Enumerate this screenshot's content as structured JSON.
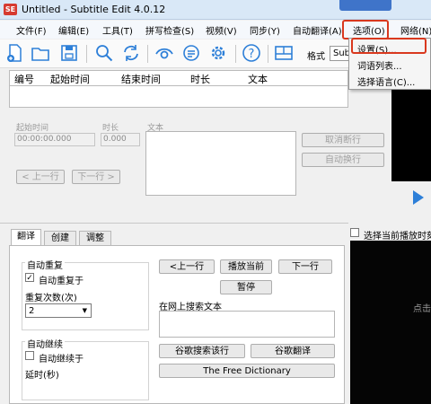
{
  "window": {
    "title": "Untitled - Subtitle Edit 4.0.12",
    "app_icon": "SE"
  },
  "menu": [
    "文件(F)",
    "编辑(E)",
    "工具(T)",
    "拼写检查(S)",
    "视频(V)",
    "同步(Y)",
    "自动翻译(A)",
    "选项(O)",
    "网络(N)"
  ],
  "options_menu": [
    "设置(S)...",
    "词语列表...",
    "选择语言(C)..."
  ],
  "toolbar": {
    "format_label": "格式",
    "format_value": "Sub"
  },
  "grid": {
    "columns": [
      "编号",
      "起始时间",
      "结束时间",
      "时长",
      "文本"
    ]
  },
  "editor": {
    "start_label": "起始时间",
    "start_value": "00:00:00.000",
    "duration_label": "时长",
    "duration_value": "0.000",
    "text_label": "文本",
    "prev_btn": "< 上一行",
    "next_btn": "下一行 >",
    "unbreak_btn": "取消断行",
    "autobreak_btn": "自动换行"
  },
  "tabs": [
    "翻译",
    "创建",
    "调整"
  ],
  "translate": {
    "auto_repeat_group": "自动重复",
    "auto_repeat_on": "自动重复于",
    "repeat_count_label": "重复次数(次)",
    "repeat_count_value": "2",
    "auto_continue_group": "自动继续",
    "auto_continue_on": "自动继续于",
    "delay_label": "延时(秒)",
    "prev_line_btn": "<上一行",
    "play_current_btn": "播放当前",
    "next_line_btn": "下一行",
    "pause_btn": "暂停",
    "search_label": "在网上搜索文本",
    "google_search_btn": "谷歌搜索该行",
    "google_translate_btn": "谷歌翻译",
    "free_dict_btn": "The Free Dictionary"
  },
  "video_panel": {
    "select_current_label": "选择当前播放时刻",
    "click_hint": "点击"
  },
  "colors": {
    "accent": "#d9381e",
    "title_bg": "#d9e8f7",
    "icon_blue": "#2d7fd8"
  }
}
